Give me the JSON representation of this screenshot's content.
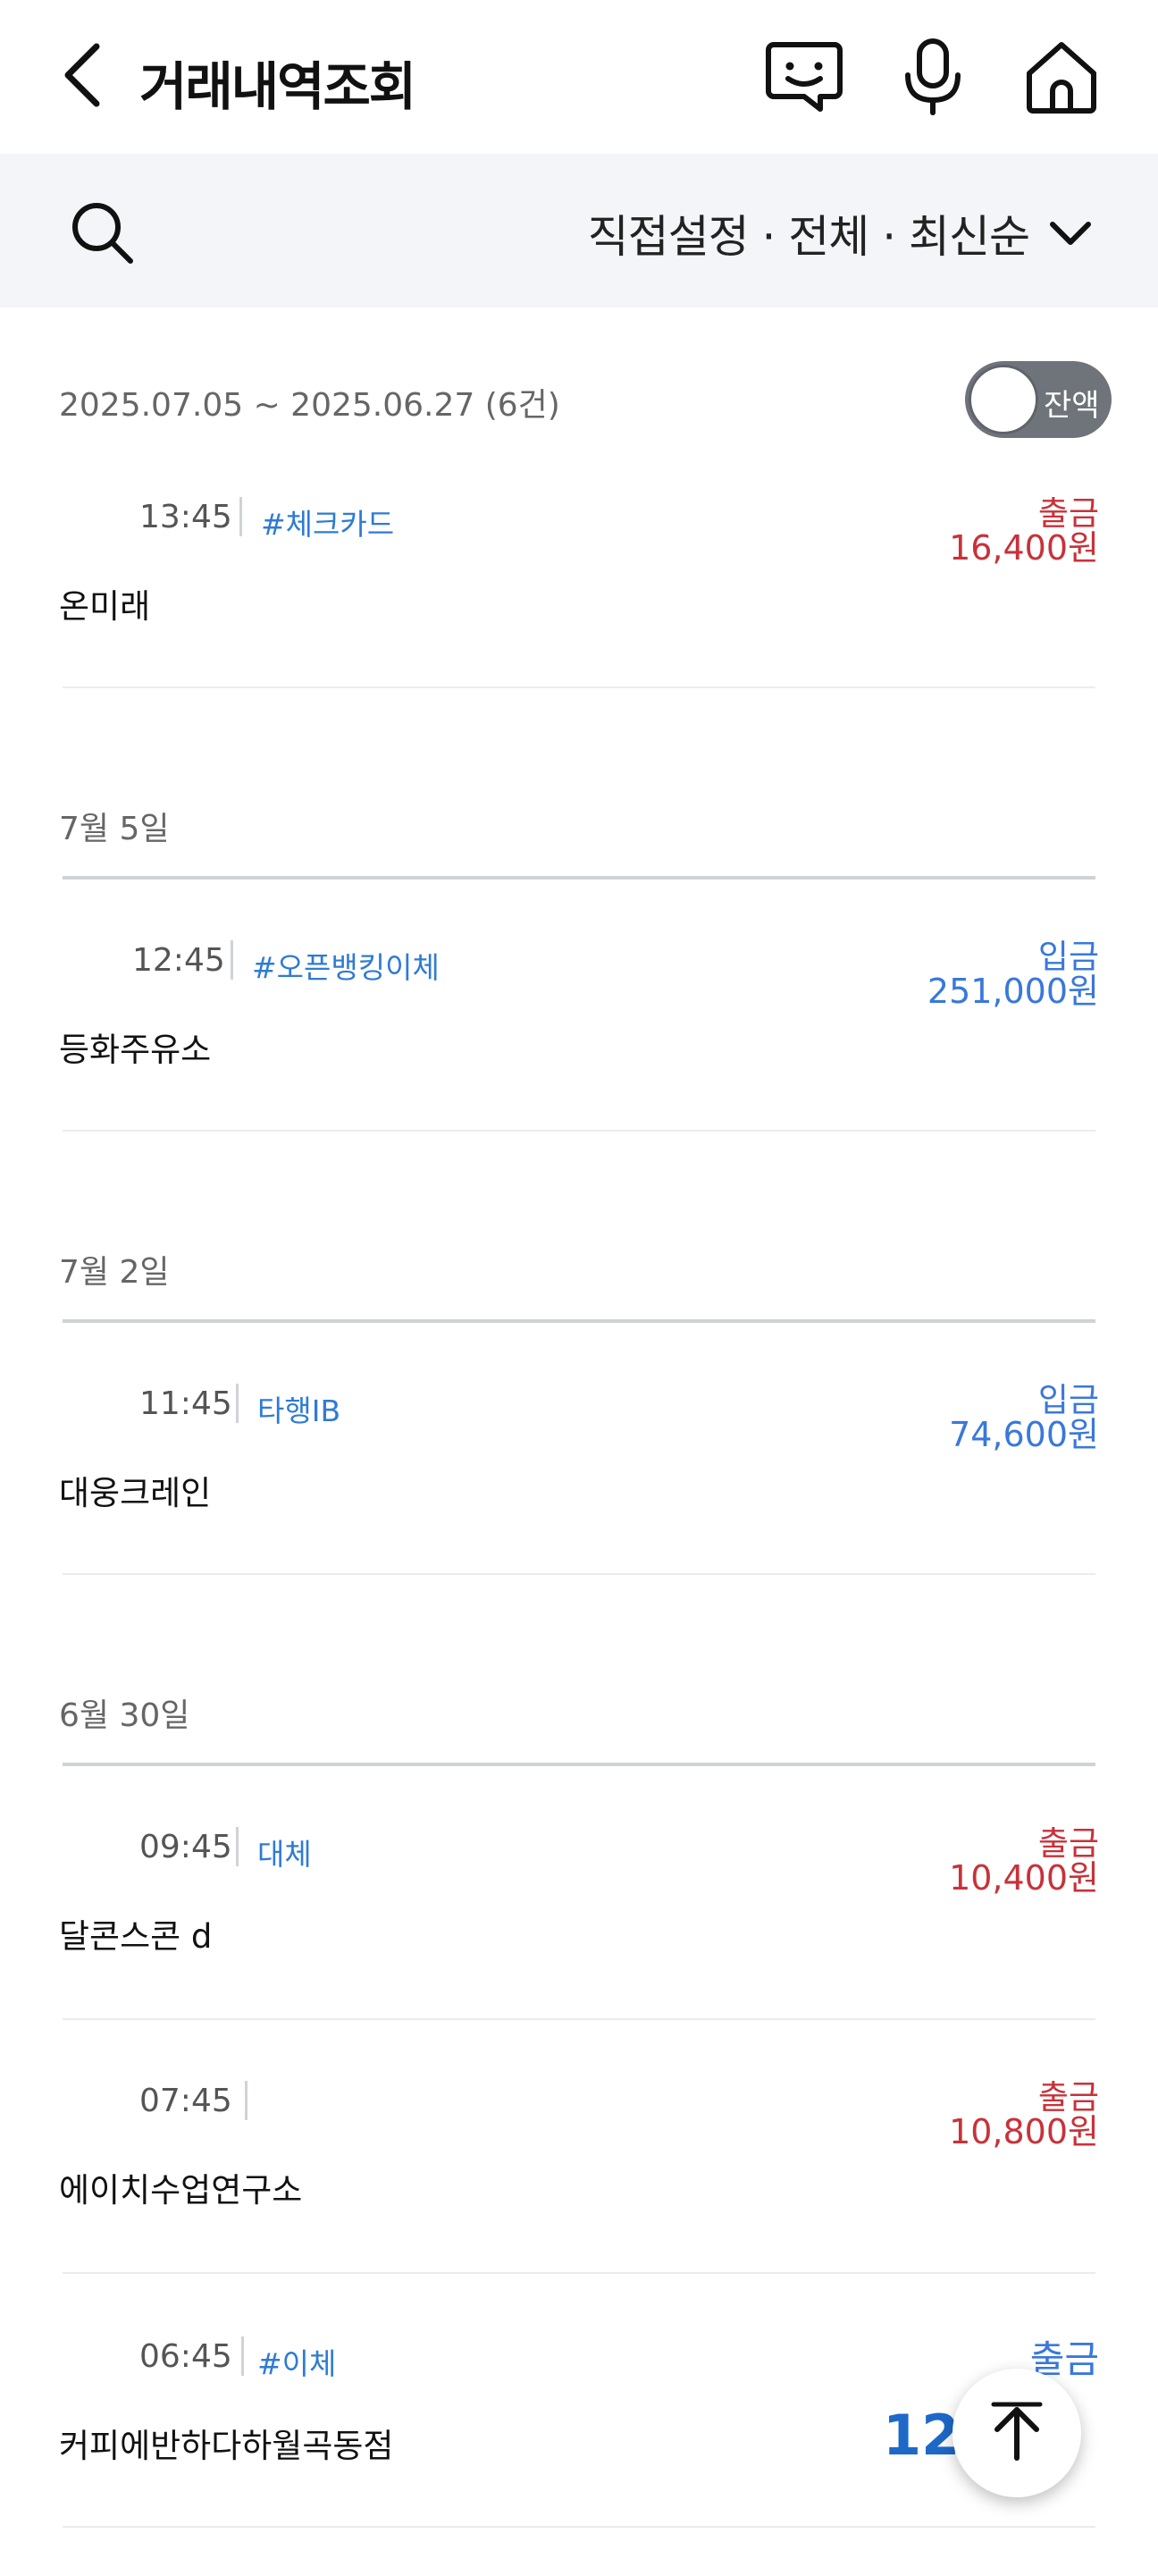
{
  "header": {
    "title": "거래내역조회",
    "icons": [
      "back-icon",
      "chatbot-icon",
      "mic-icon",
      "home-icon"
    ]
  },
  "filter": {
    "search_icon": "search-icon",
    "summary": "직접설정 · 전체 · 최신순"
  },
  "summary": {
    "range": "2025.07.05 ~ 2025.06.27 (6건)",
    "balance_toggle_label": "잔액",
    "balance_toggle_on": false
  },
  "transactions": [
    {
      "time": "13:45",
      "tag": "#체크카드",
      "type": "출금",
      "amount": "16,400원",
      "merchant": "온미래"
    },
    {
      "time": "12:45",
      "tag": "#오픈뱅킹이체",
      "type": "입금",
      "amount": "251,000원",
      "merchant": "등화주유소"
    },
    {
      "time": "11:45",
      "tag": "타행IB",
      "type": "입금",
      "amount": "74,600원",
      "merchant": "대웅크레인"
    },
    {
      "time": "09:45",
      "tag": "대체",
      "type": "출금",
      "amount": "10,400원",
      "merchant": "달콘스콘 d"
    },
    {
      "time": "07:45",
      "tag": "",
      "type": "출금",
      "amount": "10,800원",
      "merchant": "에이치수업연구소"
    },
    {
      "time": "06:45",
      "tag": "#이체",
      "type": "출금",
      "amount": "12,",
      "merchant": "커피에반하다하월곡동점"
    }
  ],
  "date_groups": [
    "7월 5일",
    "7월 2일",
    "6월 30일"
  ],
  "scroll_top_icon": "arrow-up-icon",
  "colors": {
    "withdraw": "#c8323a",
    "deposit": "#3a78db",
    "tag": "#2f7bd4",
    "filter_bg": "#f3f5f8"
  }
}
